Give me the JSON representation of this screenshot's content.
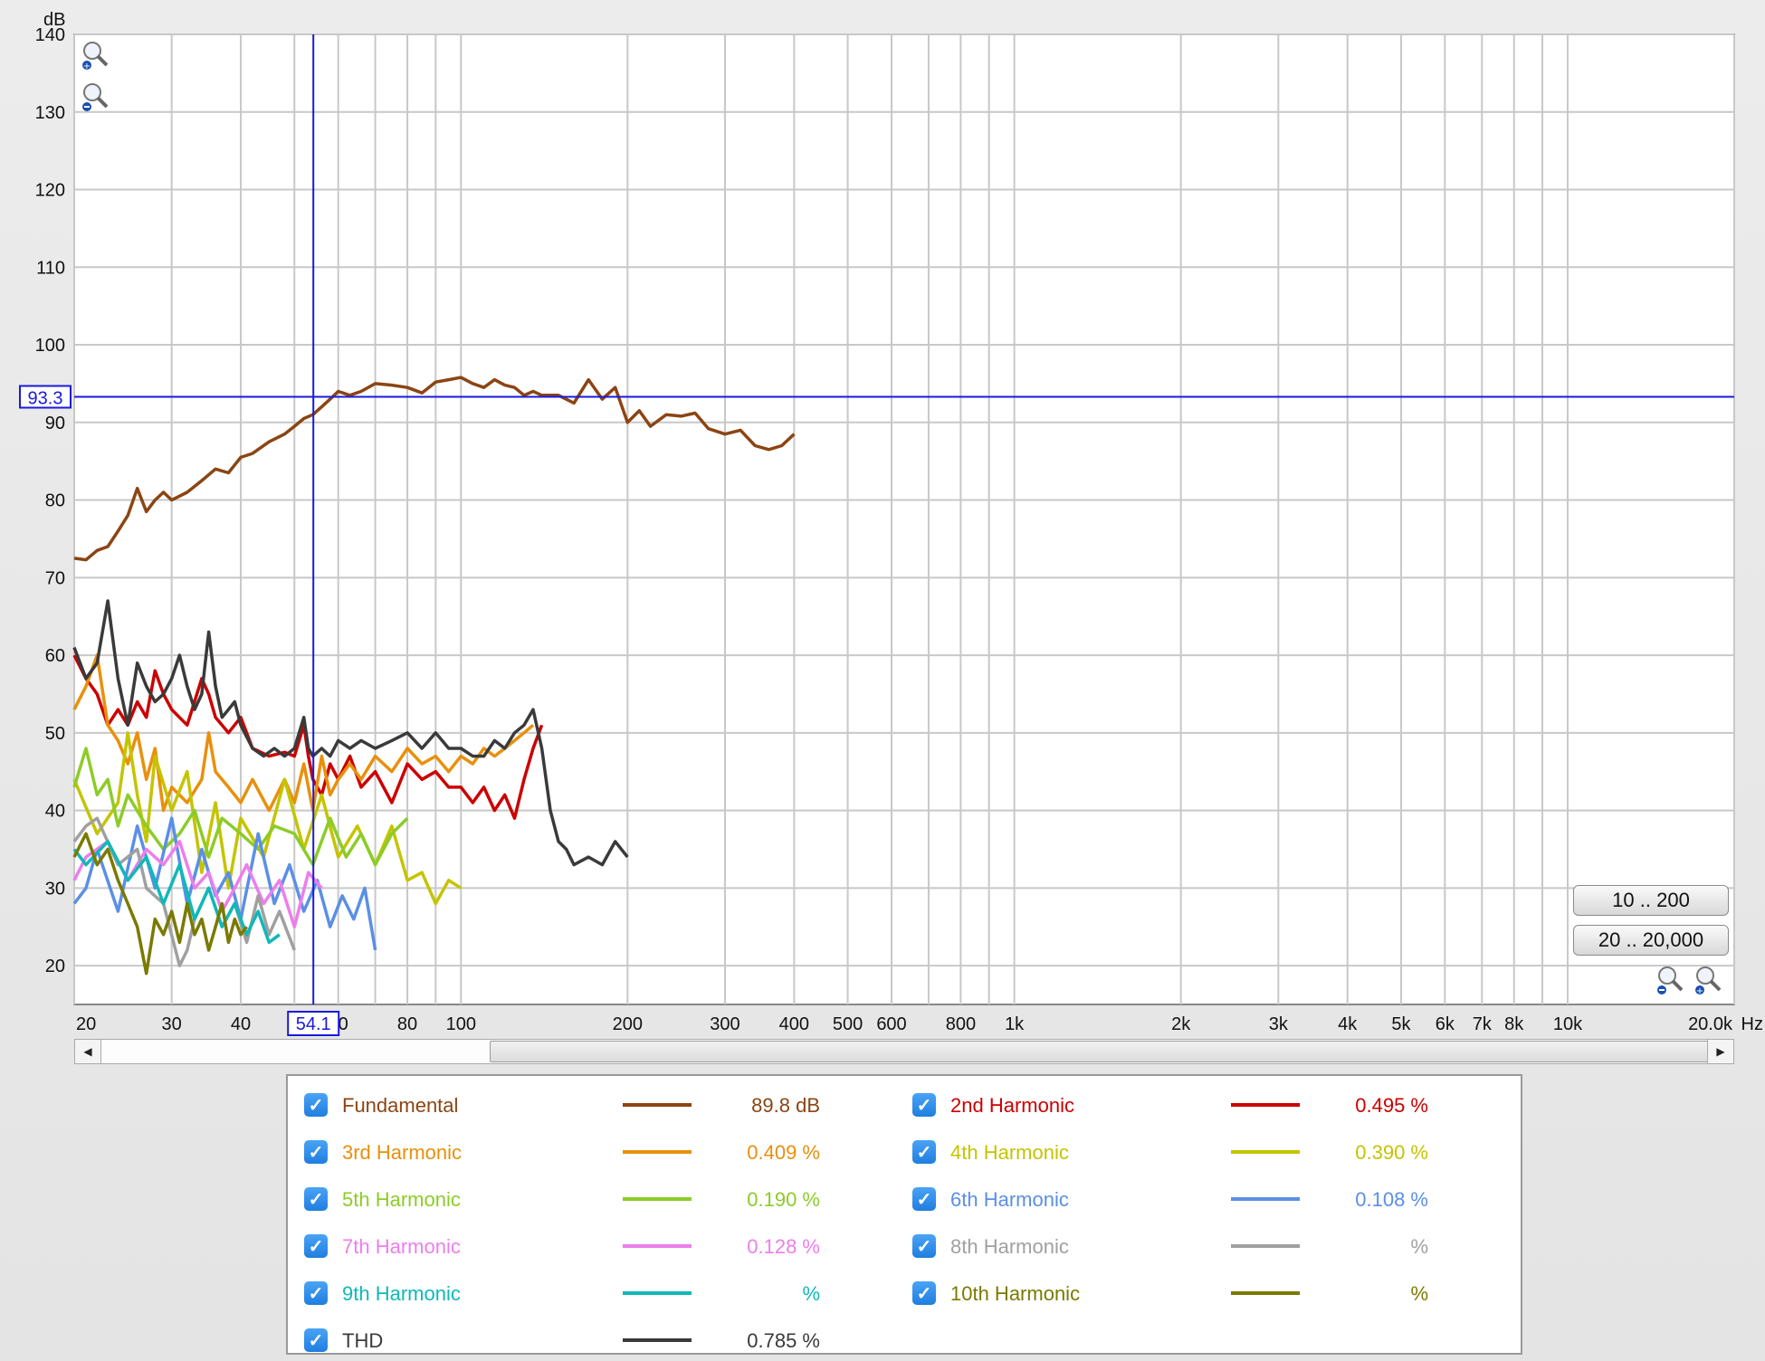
{
  "chart_data": {
    "type": "line",
    "x_scale": "log",
    "xlim": [
      20,
      20000
    ],
    "ylim": [
      15,
      140
    ],
    "ylabel": "dB",
    "xunit": "Hz",
    "y_ticks": [
      20,
      30,
      40,
      50,
      60,
      70,
      80,
      90,
      100,
      110,
      120,
      130,
      140
    ],
    "x_ticks": [
      {
        "v": 20,
        "t": "20"
      },
      {
        "v": 30,
        "t": "30"
      },
      {
        "v": 40,
        "t": "40"
      },
      {
        "v": 60,
        "t": "60"
      },
      {
        "v": 80,
        "t": "80"
      },
      {
        "v": 100,
        "t": "100"
      },
      {
        "v": 200,
        "t": "200"
      },
      {
        "v": 300,
        "t": "300"
      },
      {
        "v": 400,
        "t": "400"
      },
      {
        "v": 500,
        "t": "500"
      },
      {
        "v": 600,
        "t": "600"
      },
      {
        "v": 800,
        "t": "800"
      },
      {
        "v": 1000,
        "t": "1k"
      },
      {
        "v": 2000,
        "t": "2k"
      },
      {
        "v": 3000,
        "t": "3k"
      },
      {
        "v": 4000,
        "t": "4k"
      },
      {
        "v": 5000,
        "t": "5k"
      },
      {
        "v": 6000,
        "t": "6k"
      },
      {
        "v": 7000,
        "t": "7k"
      },
      {
        "v": 8000,
        "t": "8k"
      },
      {
        "v": 10000,
        "t": "10k"
      },
      {
        "v": 20000,
        "t": "20.0k"
      }
    ],
    "grid": true,
    "cursor": {
      "x": 54.1,
      "y": 93.3,
      "x_label": "54.1",
      "y_label": "93.3"
    },
    "series": [
      {
        "name": "Fundamental",
        "color": "#8b4513",
        "x": [
          20,
          21,
          22,
          23,
          24,
          25,
          26,
          27,
          28,
          29,
          30,
          32,
          34,
          36,
          38,
          40,
          42,
          45,
          48,
          50,
          52,
          54,
          56,
          58,
          60,
          63,
          66,
          70,
          75,
          80,
          85,
          90,
          95,
          100,
          105,
          110,
          115,
          120,
          125,
          130,
          135,
          140,
          150,
          160,
          170,
          180,
          190,
          200,
          210,
          220,
          235,
          250,
          265,
          280,
          300,
          320,
          340,
          360,
          380,
          400
        ],
        "y": [
          72.5,
          72.3,
          73.5,
          74,
          76,
          78,
          81.5,
          78.5,
          80,
          81,
          80,
          81,
          82.5,
          84,
          83.5,
          85.5,
          86,
          87.5,
          88.5,
          89.5,
          90.5,
          91,
          92,
          93,
          94,
          93.5,
          94,
          95,
          94.8,
          94.5,
          93.8,
          95.2,
          95.5,
          95.8,
          95,
          94.5,
          95.5,
          94.8,
          94.5,
          93.5,
          94,
          93.5,
          93.5,
          92.5,
          95.5,
          93,
          94.5,
          90,
          91.5,
          89.5,
          91,
          90.8,
          91.2,
          89.2,
          88.5,
          89,
          87,
          86.5,
          87,
          88.5
        ]
      },
      {
        "name": "2nd Harmonic",
        "color": "#cc0000",
        "x": [
          20,
          21,
          22,
          23,
          24,
          25,
          26,
          27,
          28,
          29,
          30,
          32,
          34,
          35,
          36,
          38,
          40,
          42,
          45,
          48,
          50,
          52,
          53,
          54,
          56,
          58,
          60,
          63,
          66,
          70,
          75,
          80,
          85,
          90,
          95,
          100,
          105,
          110,
          115,
          120,
          125,
          130,
          135,
          140
        ],
        "y": [
          60,
          57,
          55,
          51,
          53,
          51,
          54,
          52,
          58,
          55,
          53,
          51,
          57,
          55,
          52,
          50,
          52,
          48,
          47,
          47.5,
          47,
          51,
          47,
          44,
          42,
          46,
          44,
          47,
          43,
          45,
          41,
          46,
          44,
          45,
          43,
          43,
          41,
          43,
          40,
          42,
          39,
          44,
          48,
          51
        ]
      },
      {
        "name": "3rd Harmonic",
        "color": "#e8900c",
        "x": [
          20,
          21,
          22,
          23,
          24,
          25,
          26,
          27,
          28,
          29,
          30,
          32,
          34,
          35,
          36,
          38,
          40,
          42,
          45,
          48,
          50,
          52,
          54,
          56,
          58,
          60,
          63,
          66,
          70,
          75,
          80,
          85,
          90,
          95,
          100,
          105,
          110,
          115,
          120,
          125,
          130,
          135
        ],
        "y": [
          53,
          56,
          60,
          51,
          49,
          46,
          50,
          44,
          48,
          40,
          43,
          41,
          44,
          50,
          45,
          43,
          41,
          44,
          40,
          44,
          41,
          46,
          40,
          47,
          42,
          44,
          46,
          44,
          47,
          45,
          48,
          46,
          47,
          45,
          47,
          46,
          48,
          47,
          48,
          49,
          50,
          51
        ]
      },
      {
        "name": "4th Harmonic",
        "color": "#c4c400",
        "x": [
          20,
          22,
          24,
          25,
          26,
          27,
          28,
          30,
          32,
          34,
          36,
          38,
          40,
          44,
          48,
          52,
          56,
          60,
          65,
          70,
          75,
          80,
          85,
          90,
          95,
          100
        ],
        "y": [
          44,
          37,
          41,
          50,
          42,
          36,
          47,
          40,
          45,
          32,
          41,
          30,
          39,
          34,
          44,
          35,
          42,
          34,
          38,
          33,
          38,
          31,
          32,
          28,
          31,
          30
        ]
      },
      {
        "name": "5th Harmonic",
        "color": "#8ccc28",
        "x": [
          20,
          21,
          22,
          23,
          24,
          25,
          27,
          29,
          31,
          33,
          35,
          37,
          40,
          43,
          46,
          50,
          54,
          58,
          62,
          66,
          70,
          75,
          80
        ],
        "y": [
          43,
          48,
          42,
          44,
          38,
          42,
          38,
          35,
          37,
          40,
          34,
          39,
          37,
          35,
          38,
          37,
          33,
          39,
          34,
          37,
          33,
          37,
          39
        ]
      },
      {
        "name": "6th Harmonic",
        "color": "#5b8fe6",
        "x": [
          20,
          21,
          22,
          24,
          26,
          28,
          30,
          32,
          34,
          36,
          38,
          40,
          43,
          46,
          49,
          52,
          55,
          58,
          61,
          64,
          67,
          70
        ],
        "y": [
          28,
          30,
          35,
          27,
          38,
          30,
          39,
          28,
          35,
          29,
          32,
          26,
          37,
          28,
          33,
          27,
          31,
          25,
          29,
          26,
          30,
          22
        ]
      },
      {
        "name": "7th Harmonic",
        "color": "#ec7eec",
        "x": [
          20,
          21,
          23,
          25,
          27,
          29,
          31,
          33,
          35,
          37,
          39,
          41,
          44,
          47,
          50,
          53,
          56
        ],
        "y": [
          31,
          34,
          36,
          31,
          35,
          33,
          36,
          30,
          32,
          27,
          30,
          33,
          28,
          31,
          25,
          32,
          30
        ]
      },
      {
        "name": "8th Harmonic",
        "color": "#a0a0a0",
        "x": [
          20,
          21,
          22,
          24,
          26,
          27,
          29,
          31,
          32,
          33,
          35,
          37,
          39,
          41,
          43,
          45,
          47,
          50
        ],
        "y": [
          36,
          38,
          39,
          33,
          35,
          30,
          28,
          20,
          22,
          26,
          30,
          25,
          28,
          23,
          29,
          24,
          27,
          22
        ]
      },
      {
        "name": "9th Harmonic",
        "color": "#10b8b8",
        "x": [
          20,
          21,
          23,
          25,
          27,
          29,
          31,
          33,
          35,
          37,
          39,
          41,
          43,
          45,
          47
        ],
        "y": [
          35,
          33,
          36,
          31,
          34,
          28,
          33,
          26,
          30,
          25,
          28,
          24,
          27,
          23,
          24
        ]
      },
      {
        "name": "10th Harmonic",
        "color": "#7a7a00",
        "x": [
          20,
          21,
          22,
          23,
          24,
          25,
          26,
          27,
          28,
          29,
          30,
          31,
          32,
          33,
          34,
          35,
          36,
          37,
          38,
          39,
          40,
          41
        ],
        "y": [
          34,
          37,
          33,
          35,
          31,
          28,
          25,
          19,
          26,
          24,
          27,
          23,
          28,
          24,
          26,
          22,
          25,
          28,
          23,
          26,
          24,
          25
        ]
      },
      {
        "name": "THD",
        "color": "#3a3a3a",
        "x": [
          20,
          21,
          22,
          23,
          24,
          25,
          26,
          27,
          28,
          29,
          30,
          31,
          32,
          33,
          34,
          35,
          36,
          37,
          38,
          39,
          40,
          42,
          44,
          46,
          48,
          50,
          52,
          53,
          54,
          56,
          58,
          60,
          63,
          66,
          70,
          75,
          80,
          85,
          90,
          95,
          100,
          105,
          110,
          115,
          120,
          125,
          130,
          135,
          140,
          145,
          150,
          155,
          160,
          170,
          180,
          190,
          200
        ],
        "y": [
          61,
          57,
          59,
          67,
          57,
          51,
          59,
          56,
          54,
          55,
          57,
          60,
          56,
          53,
          55,
          63,
          56,
          52,
          53,
          54,
          51,
          48,
          47,
          48,
          47,
          48,
          52,
          48,
          47,
          48,
          47,
          49,
          48,
          49,
          48,
          49,
          50,
          48,
          50,
          48,
          48,
          47,
          47,
          49,
          48,
          50,
          51,
          53,
          48,
          40,
          36,
          35,
          33,
          34,
          33,
          36,
          34
        ]
      }
    ]
  },
  "legend": [
    {
      "name": "Fundamental",
      "value": "89.8 dB",
      "color": "#8b4513"
    },
    {
      "name": "2nd Harmonic",
      "value": "0.495 %",
      "color": "#cc0000"
    },
    {
      "name": "3rd Harmonic",
      "value": "0.409 %",
      "color": "#e8900c"
    },
    {
      "name": "4th Harmonic",
      "value": "0.390 %",
      "color": "#c4c400"
    },
    {
      "name": "5th Harmonic",
      "value": "0.190 %",
      "color": "#8ccc28"
    },
    {
      "name": "6th Harmonic",
      "value": "0.108 %",
      "color": "#5b8fe6"
    },
    {
      "name": "7th Harmonic",
      "value": "0.128 %",
      "color": "#ec7eec"
    },
    {
      "name": "8th Harmonic",
      "value": "%",
      "color": "#a0a0a0"
    },
    {
      "name": "9th Harmonic",
      "value": "%",
      "color": "#10b8b8"
    },
    {
      "name": "10th Harmonic",
      "value": "%",
      "color": "#7a7a00"
    },
    {
      "name": "THD",
      "value": "0.785 %",
      "color": "#3a3a3a"
    }
  ],
  "controls": {
    "range_button_1": "10 .. 200",
    "range_button_2": "20 .. 20,000",
    "zoom_in_icon": "magnifier-plus-icon",
    "zoom_out_icon": "magnifier-minus-icon",
    "checkbox_icon": "checkmark-icon"
  }
}
